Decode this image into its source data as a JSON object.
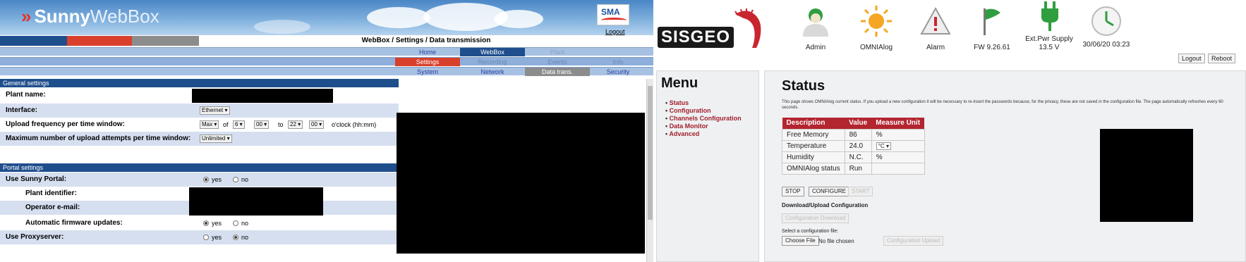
{
  "left": {
    "brand": {
      "chevron": "»",
      "name_bold": "Sunny",
      "name_light": "WebBox"
    },
    "sma_logo_text": "SMA",
    "logout": "Logout",
    "breadcrumb": "WebBox / Settings / Data transmission",
    "nav_top": [
      "Home",
      "WebBox",
      "Plant"
    ],
    "nav_mid": [
      "Settings",
      "Recording",
      "Events",
      "Info"
    ],
    "nav_sub": [
      "System",
      "Network",
      "Data trans.",
      "Security"
    ],
    "general": {
      "header": "General settings",
      "plant_name_label": "Plant name:",
      "interface_label": "Interface:",
      "interface_value": "Ethernet",
      "upload_freq_label": "Upload frequency per time window:",
      "upload_freq": {
        "mode": "Max",
        "of": "of",
        "from_h": "6",
        "from_m": "00",
        "to": "to",
        "to_h": "22",
        "to_m": "00",
        "suffix": "o'clock (hh:mm)"
      },
      "max_attempts_label": "Maximum number of upload attempts per time window:",
      "max_attempts_value": "Unlimited"
    },
    "portal": {
      "header": "Portal settings",
      "use_portal_label": "Use Sunny Portal:",
      "plant_id_label": "Plant identifier:",
      "operator_email_label": "Operator e-mail:",
      "auto_fw_label": "Automatic firmware updates:",
      "proxy_label": "Use Proxyserver:",
      "yes": "yes",
      "no": "no"
    }
  },
  "right": {
    "logo": "SISGEO",
    "status_items": [
      {
        "icon": "user-icon",
        "label": "Admin"
      },
      {
        "icon": "sun-icon",
        "label": "OMNIAlog"
      },
      {
        "icon": "warning-icon",
        "label": "Alarm"
      },
      {
        "icon": "flag-icon",
        "label": "FW 9.26.61"
      },
      {
        "icon": "plug-icon",
        "label": "Ext.Pwr Supply 13.5 V"
      },
      {
        "icon": "clock-icon",
        "label": "30/06/20 03:23"
      }
    ],
    "logout": "Logout",
    "reboot": "Reboot",
    "menu": {
      "title": "Menu",
      "items": [
        "Status",
        "Configuration",
        "Channels Configuration",
        "Data Monitor",
        "Advanced"
      ]
    },
    "status": {
      "title": "Status",
      "description": "This page shows OMNIAlog current status. If you upload a new configuration it will be necessary to re-insert the passwords because, for the privacy, these are not saved in the configuration file. The page automatically refreshes every 60 seconds.",
      "columns": [
        "Description",
        "Value",
        "Measure Unit"
      ],
      "rows": [
        [
          "Free Memory",
          "86",
          "%"
        ],
        [
          "Temperature",
          "24.0",
          "°C"
        ],
        [
          "Humidity",
          "N.C.",
          "%"
        ],
        [
          "OMNIAlog status",
          "Run",
          ""
        ]
      ],
      "buttons": {
        "stop": "STOP",
        "configure": "CONFIGURE",
        "start": "START"
      },
      "download_upload_header": "Download/Upload Configuration",
      "config_download": "Configuration Download",
      "select_file_label": "Select a configuration file:",
      "choose_file": "Choose File",
      "no_file": "No file chosen",
      "config_upload": "Configuration Upload"
    }
  },
  "colors": {
    "webbox_section": "#1f4e8c",
    "webbox_nav": "#a7c1e3",
    "webbox_active_red": "#d8402c",
    "webbox_active_blue": "#1f4e8c",
    "webbox_active_gray": "#8c8c8c",
    "sisgeo_red": "#b3252f"
  }
}
